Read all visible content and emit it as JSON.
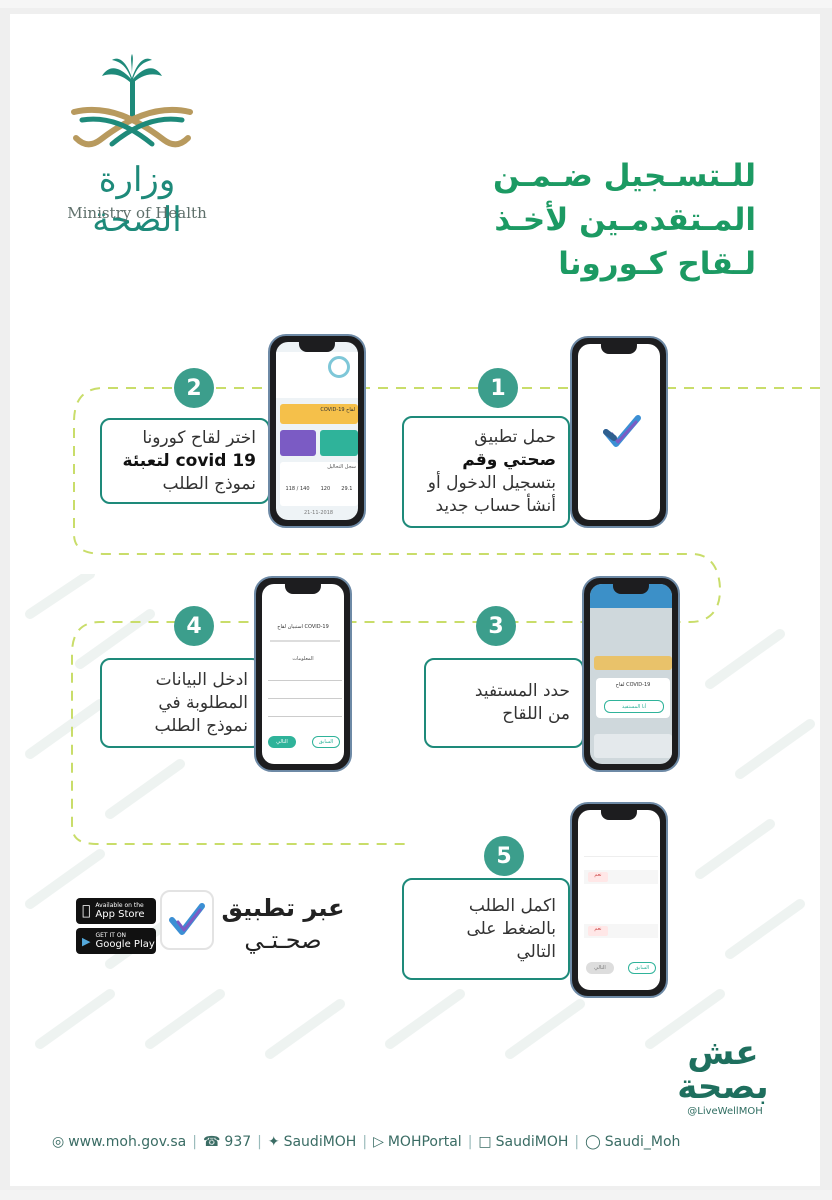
{
  "ministry": {
    "name_ar": "وزارة الصحة",
    "name_en": "Ministry of Health"
  },
  "title_lines": [
    "للـتسـجيل ضـمـن",
    "المـتقدمـين لأخـذ",
    "لـقاح كـورونا"
  ],
  "steps": [
    {
      "number": "1",
      "lines": [
        "حمل تطبيق",
        "صحتي وقم",
        "بتسجيل الدخول أو",
        "أنشأ حساب جديد"
      ]
    },
    {
      "number": "2",
      "lines": [
        "اختر لقاح كورونا",
        "covid 19 لتعبئة",
        "نموذج الطلب"
      ]
    },
    {
      "number": "3",
      "lines": [
        "حدد المستفيد",
        "من اللقاح"
      ]
    },
    {
      "number": "4",
      "lines": [
        "ادخل البيانات",
        "المطلوبة في",
        "نموذج الطلب"
      ]
    },
    {
      "number": "5",
      "lines": [
        "اكمل الطلب",
        "بالضغط على",
        "التالي"
      ]
    }
  ],
  "via_app": {
    "line1": "عبر تطبيق",
    "line2": "صحـتـي"
  },
  "stores": {
    "apple_small": "Available on the",
    "apple_big": "App Store",
    "google_small": "GET IT ON",
    "google_big": "Google Play"
  },
  "campaign": {
    "text": "عش بصحة",
    "handle": "@LiveWellMOH"
  },
  "footer": {
    "website": "www.moh.gov.sa",
    "phone": "937",
    "twitter": "SaudiMOH",
    "youtube": "MOHPortal",
    "facebook": "SaudiMOH",
    "snapchat": "Saudi_Moh"
  },
  "screens": {
    "s2_card": "لقاح COVID-19",
    "s2_lab": "سجل التحاليل",
    "s2_values": [
      "29.1",
      "120",
      "118 / 140"
    ],
    "s2_date": "21-11-2018",
    "s3_dialog": "لقاح COVID-19",
    "s3_btn": "أنا المستفيد",
    "s4_header": "استبيان لقاح COVID-19",
    "s4_section": "المعلومات",
    "s4_next": "التالي",
    "s4_prev": "السابق",
    "s5_yes": "نعم",
    "s5_next": "التالي",
    "s5_prev": "السابق"
  }
}
